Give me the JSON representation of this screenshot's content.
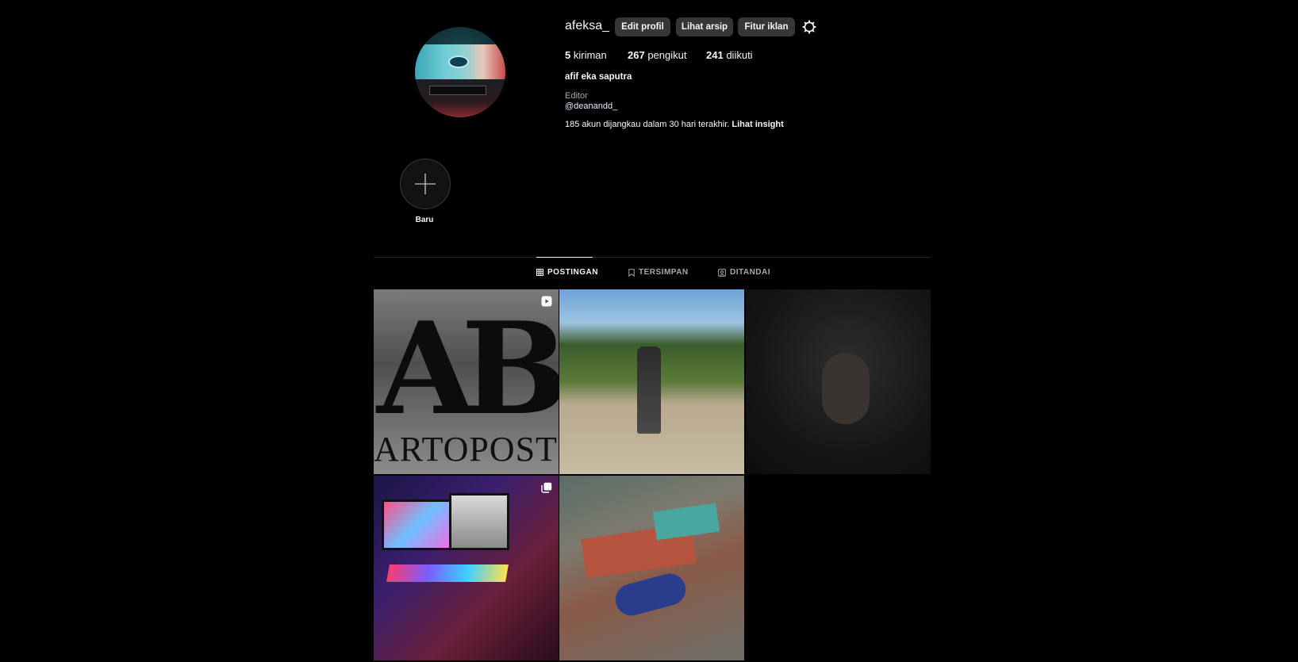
{
  "profile": {
    "username": "afeksa_",
    "full_name": "afif eka saputra",
    "category": "Editor",
    "handle": "@deanandd_",
    "insight_text": "185 akun dijangkau dalam 30 hari terakhir.",
    "insight_link": "Lihat insight"
  },
  "buttons": {
    "edit_profile": "Edit profil",
    "view_archive": "Lihat arsip",
    "ad_tools": "Fitur iklan"
  },
  "stats": {
    "posts_count": "5",
    "posts_label": "kiriman",
    "followers_count": "267",
    "followers_label": "pengikut",
    "following_count": "241",
    "following_label": "diikuti"
  },
  "highlights": {
    "new_label": "Baru"
  },
  "tabs": [
    {
      "label": "POSTINGAN",
      "icon": "grid-icon",
      "active": true
    },
    {
      "label": "TERSIMPAN",
      "icon": "bookmark-icon",
      "active": false
    },
    {
      "label": "DITANDAI",
      "icon": "tagged-icon",
      "active": false
    }
  ],
  "posts": [
    {
      "type": "reel",
      "icon": "reel-icon",
      "text_lines": [
        "AB",
        "ARTOPOST"
      ]
    },
    {
      "type": "photo",
      "icon": null
    },
    {
      "type": "photo",
      "icon": null
    },
    {
      "type": "carousel",
      "icon": "carousel-icon"
    },
    {
      "type": "photo",
      "icon": null
    }
  ],
  "colors": {
    "background": "#000000",
    "button": "#363636",
    "text_primary": "#f5f5f5",
    "text_secondary": "#a8a8a8"
  }
}
